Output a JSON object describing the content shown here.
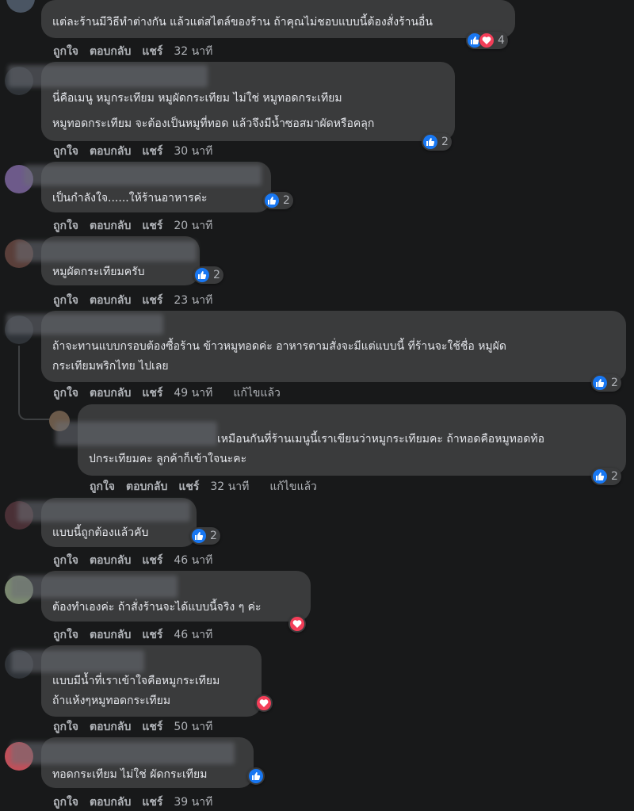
{
  "actions": {
    "like": "ถูกใจ",
    "reply": "ตอบกลับ",
    "share": "แชร์",
    "edited": "แก้ไขแล้ว"
  },
  "comments": [
    {
      "lines": [
        "แต่ละร้านมีวิธีทำต่างกัน แล้วแต่สไตล์ของร้าน ถ้าคุณไม่ชอบแบบนี้ต้องสั่งร้านอื่น"
      ],
      "time": "32 นาที",
      "reactions": [
        "like",
        "love"
      ],
      "count": "4"
    },
    {
      "lines": [
        "นี่คือเมนู หมูกระเทียม หมูผัดกระเทียม ไม่ใช่ หมูทอดกระเทียม",
        "หมูทอดกระเทียม จะต้องเป็นหมูที่ทอด แล้วจึงมีน้ำซอสมาผัดหรือคลุก"
      ],
      "time": "30 นาที",
      "reactions": [
        "like"
      ],
      "count": "2"
    },
    {
      "lines": [
        "เป็นกำลังใจ......ให้ร้านอาหารค่ะ"
      ],
      "time": "20 นาที",
      "reactions": [
        "like"
      ],
      "count": "2"
    },
    {
      "lines": [
        "หมูผัดกระเทียมครับ"
      ],
      "time": "23 นาที",
      "reactions": [
        "like"
      ],
      "count": "2"
    },
    {
      "lines": [
        "ถ้าจะทานแบบกรอบต้องซื้อร้าน ข้าวหมูทอดค่ะ อาหารตามสั่งจะมีแต่แบบนี้ ที่ร้านจะใช้ชื่อ หมูผัด",
        "กระเทียมพริกไทย ไปเลย"
      ],
      "time": "49 นาที",
      "reactions": [
        "like"
      ],
      "count": "2"
    },
    {
      "lines": [
        "เหมือนกันที่ร้านเมนูนี้เราเขียนว่าหมูกระเทียมคะ ถ้าทอดคือหมูทอดท้อ",
        "ปกระเทียมคะ ลูกค้าก็เข้าใจนะคะ"
      ],
      "time": "32 นาที",
      "reactions": [
        "like"
      ],
      "count": "2"
    },
    {
      "lines": [
        "แบบนี้ถูกต้องแล้วคับ"
      ],
      "time": "46 นาที",
      "reactions": [
        "like"
      ],
      "count": "2"
    },
    {
      "lines": [
        "ต้องทำเองค่ะ ถ้าสั่งร้านจะได้แบบนี้จริง ๆ ค่ะ"
      ],
      "time": "46 นาที",
      "reactions": [
        "love"
      ],
      "count": ""
    },
    {
      "lines": [
        "แบบมีน้ำที่เราเข้าใจคือหมูกระเทียม",
        "ถ้าแห้งๆหมูทอดกระเทียม"
      ],
      "time": "50 นาที",
      "reactions": [
        "love"
      ],
      "count": ""
    },
    {
      "lines": [
        "ทอดกระเทียม ไม่ใช่ ผัดกระเทียม"
      ],
      "time": "39 นาที",
      "reactions": [
        "like"
      ],
      "count": ""
    }
  ]
}
